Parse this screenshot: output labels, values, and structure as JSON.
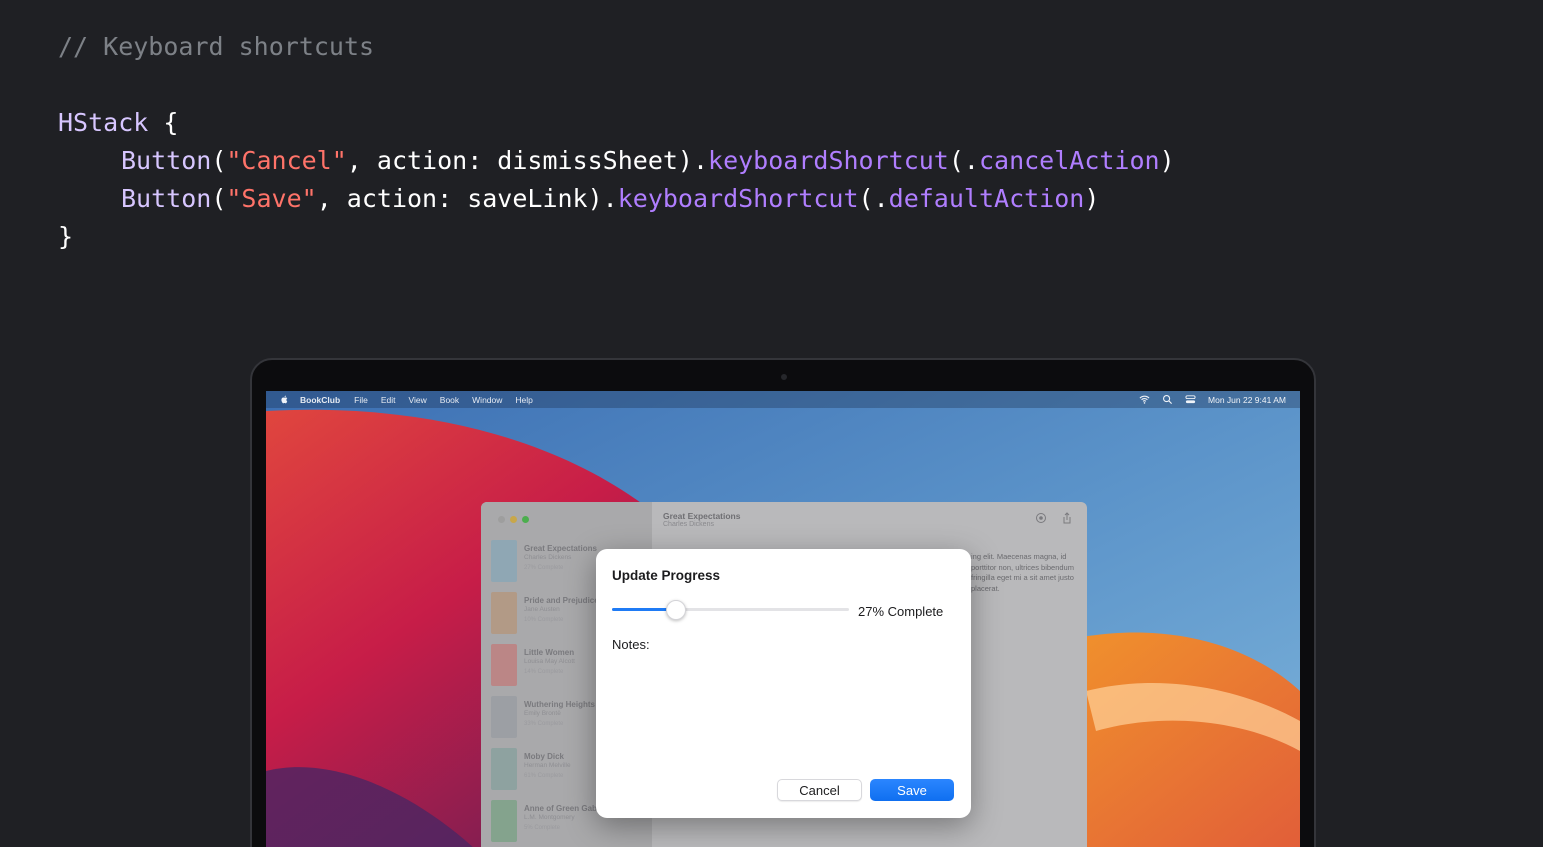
{
  "code": {
    "comment": "// Keyboard shortcuts",
    "hstack": "HStack",
    "open_brace": " {",
    "close_brace": "}",
    "button_kw": "Button",
    "line1": {
      "open": "(",
      "label": "\"Cancel\"",
      "middle": ", action: dismissSheet).",
      "modifier": "keyboardShortcut",
      "arg_open": "(.",
      "arg": "cancelAction",
      "close": ")"
    },
    "line2": {
      "open": "(",
      "label": "\"Save\"",
      "middle": ", action: saveLink).",
      "modifier": "keyboardShortcut",
      "arg_open": "(.",
      "arg": "defaultAction",
      "close": ")"
    }
  },
  "menubar": {
    "app_name": "BookClub",
    "items": [
      "File",
      "Edit",
      "View",
      "Book",
      "Window",
      "Help"
    ],
    "clock": "Mon Jun 22  9:41 AM",
    "icons": [
      "apple-icon",
      "wifi-icon",
      "search-icon",
      "control-center-icon"
    ]
  },
  "app_window": {
    "title": "Great Expectations",
    "subtitle": "Charles Dickens",
    "books": [
      {
        "title": "Great Expectations",
        "author": "Charles Dickens",
        "progress": "27% Complete",
        "color": "#8fa7b4"
      },
      {
        "title": "Pride and Prejudice",
        "author": "Jane Austen",
        "progress": "10% Complete",
        "color": "#b29a86"
      },
      {
        "title": "Little Women",
        "author": "Louisa May Alcott",
        "progress": "14% Complete",
        "color": "#bb8686"
      },
      {
        "title": "Wuthering Heights",
        "author": "Emily Brontë",
        "progress": "33% Complete",
        "color": "#9c9fa4"
      },
      {
        "title": "Moby Dick",
        "author": "Herman Melville",
        "progress": "61% Complete",
        "color": "#8ea2a0"
      },
      {
        "title": "Anne of Green Gables",
        "author": "L.M. Montgomery",
        "progress": "5% Complete",
        "color": "#84a38d"
      }
    ],
    "body_text": "ing elit. Maecenas magna, id porttitor non, ultrices bibendum fringilla eget mi a sit amet justo placerat."
  },
  "sheet": {
    "title": "Update Progress",
    "progress": 0.27,
    "progress_label": "27% Complete",
    "notes_label": "Notes:",
    "cancel_label": "Cancel",
    "save_label": "Save",
    "accent": "#1f7bf5"
  }
}
